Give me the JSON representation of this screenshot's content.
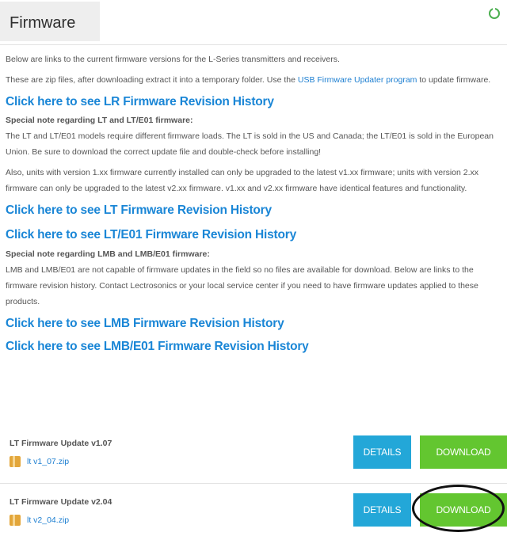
{
  "header": {
    "title": "Firmware"
  },
  "intro": {
    "line1": "Below are links to the current firmware versions for the L-Series transmitters and receivers.",
    "line2_before": "These are zip files, after downloading extract it into a temporary folder. Use the ",
    "line2_link": "USB Firmware Updater program",
    "line2_after": " to update firmware."
  },
  "links": {
    "lr_history": "Click here to see LR Firmware Revision History",
    "lt_history": "Click here to see LT Firmware Revision History",
    "lte01_history": "Click here to see LT/E01 Firmware Revision History",
    "lmb_history": "Click here to see LMB Firmware Revision History",
    "lmbe01_history": "Click here to see LMB/E01 Firmware Revision History"
  },
  "lt_note": {
    "title": "Special note regarding LT and LT/E01 firmware:",
    "body1": "The LT and LT/E01 models require different firmware loads. The LT is sold in the US and Canada; the LT/E01 is sold in the European Union. Be sure to download the correct update file and double-check before installing!",
    "body2": "Also, units with version 1.xx firmware currently installed can only be upgraded to the latest v1.xx firmware; units with version 2.xx firmware can only be upgraded to the latest v2.xx firmware. v1.xx and v2.xx firmware have identical features and functionality."
  },
  "lmb_note": {
    "title": "Special note regarding LMB and LMB/E01 firmware:",
    "body": "LMB and LMB/E01 are not capable of firmware updates in the field so no files are available for download. Below are links to the firmware revision history. Contact Lectrosonics or your local service center if you need to have firmware updates applied to these products."
  },
  "downloads": [
    {
      "title": "LT Firmware Update v1.07",
      "file": "lt v1_07.zip",
      "details_label": "DETAILS",
      "download_label": "DOWNLOAD"
    },
    {
      "title": "LT Firmware Update v2.04",
      "file": "lt v2_04.zip",
      "details_label": "DETAILS",
      "download_label": "DOWNLOAD"
    }
  ],
  "colors": {
    "link_blue": "#1a86d6",
    "details_button": "#23a7d8",
    "download_button": "#63c630",
    "zip_icon": "#e3a63a"
  }
}
